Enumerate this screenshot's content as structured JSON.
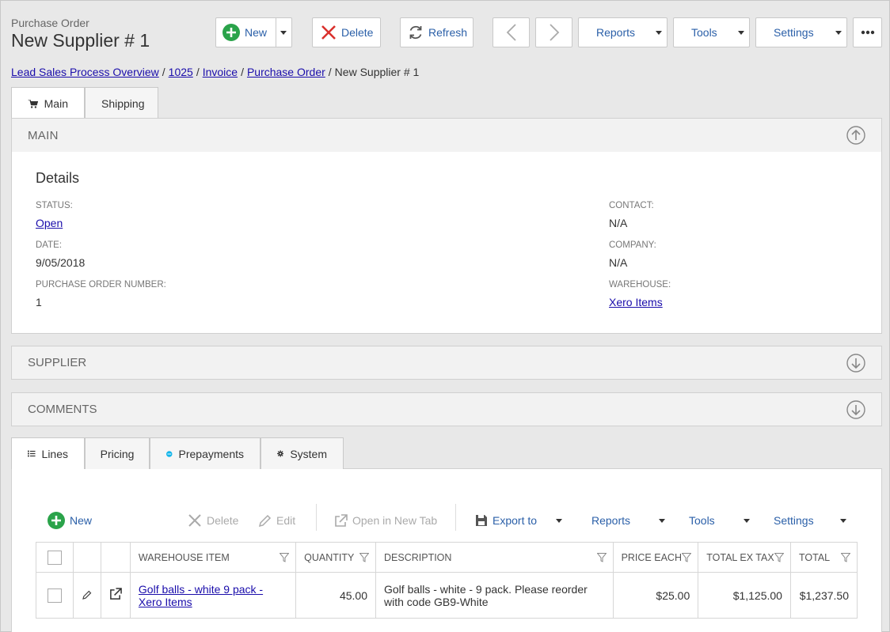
{
  "header": {
    "subtitle": "Purchase Order",
    "title": "New Supplier # 1"
  },
  "toolbar": {
    "new_label": "New",
    "delete_label": "Delete",
    "refresh_label": "Refresh",
    "reports_label": "Reports",
    "tools_label": "Tools",
    "settings_label": "Settings"
  },
  "breadcrumb": {
    "items": [
      "Lead Sales Process Overview",
      "1025",
      "Invoice",
      "Purchase Order"
    ],
    "current": "New Supplier # 1",
    "separator": "/"
  },
  "top_tabs": [
    "Main",
    "Shipping"
  ],
  "main_panel": {
    "heading": "MAIN",
    "details_title": "Details",
    "fields": {
      "status": {
        "label": "STATUS:",
        "value": "Open"
      },
      "date": {
        "label": "DATE:",
        "value": "9/05/2018"
      },
      "po_number": {
        "label": "PURCHASE ORDER NUMBER:",
        "value": "1"
      },
      "contact": {
        "label": "CONTACT:",
        "value": "N/A"
      },
      "company": {
        "label": "COMPANY:",
        "value": "N/A"
      },
      "warehouse": {
        "label": "WAREHOUSE:",
        "value": "Xero Items"
      }
    }
  },
  "supplier_panel": {
    "heading": "SUPPLIER"
  },
  "comments_panel": {
    "heading": "COMMENTS"
  },
  "bottom_tabs": [
    "Lines",
    "Pricing",
    "Prepayments",
    "System"
  ],
  "grid_toolbar": {
    "new_label": "New",
    "delete_label": "Delete",
    "edit_label": "Edit",
    "open_tab_label": "Open in New Tab",
    "export_label": "Export to",
    "reports_label": "Reports",
    "tools_label": "Tools",
    "settings_label": "Settings"
  },
  "grid": {
    "columns": [
      "WAREHOUSE ITEM",
      "QUANTITY",
      "DESCRIPTION",
      "PRICE EACH",
      "TOTAL EX TAX",
      "TOTAL"
    ],
    "rows": [
      {
        "item": "Golf balls - white 9 pack - Xero Items",
        "quantity": "45.00",
        "description": "Golf balls - white - 9 pack. Please reorder with code GB9-White",
        "price_each": "$25.00",
        "total_ex_tax": "$1,125.00",
        "total": "$1,237.50"
      }
    ]
  },
  "colors": {
    "accent": "#2a5fa8",
    "green": "#2aa34a",
    "red": "#d9302c"
  }
}
